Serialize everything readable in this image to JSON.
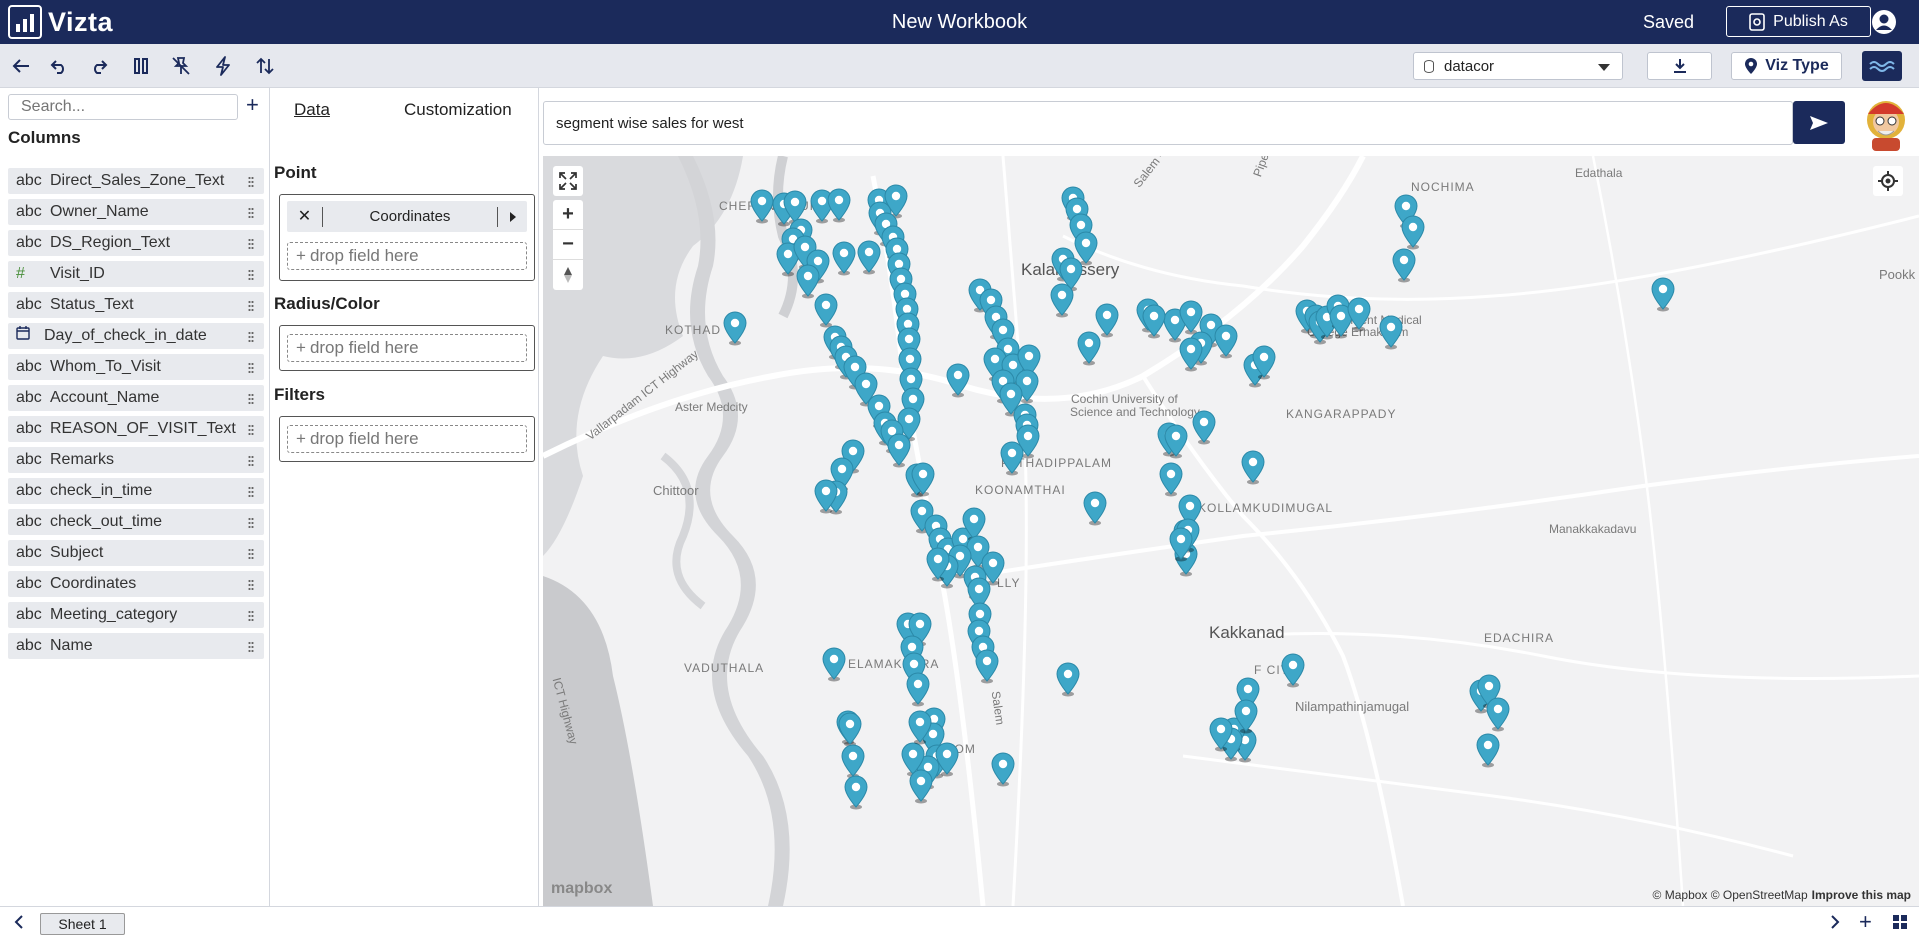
{
  "app": {
    "name": "Vizta",
    "workbook_title": "New Workbook",
    "save_status": "Saved",
    "publish_label": "Publish As"
  },
  "toolbar": {
    "datasource": "datacor",
    "viz_type_label": "Viz Type"
  },
  "columns_panel": {
    "search_placeholder": "Search...",
    "heading": "Columns",
    "columns": [
      {
        "type": "abc",
        "name": "Direct_Sales_Zone_Text"
      },
      {
        "type": "abc",
        "name": "Owner_Name"
      },
      {
        "type": "abc",
        "name": "DS_Region_Text"
      },
      {
        "type": "#",
        "name": "Visit_ID"
      },
      {
        "type": "abc",
        "name": "Status_Text"
      },
      {
        "type": "date-icon",
        "name": "Day_of_check_in_date"
      },
      {
        "type": "abc",
        "name": "Whom_To_Visit"
      },
      {
        "type": "abc",
        "name": "Account_Name"
      },
      {
        "type": "abc",
        "name": "REASON_OF_VISIT_Text"
      },
      {
        "type": "abc",
        "name": "Remarks"
      },
      {
        "type": "abc",
        "name": "check_in_time"
      },
      {
        "type": "abc",
        "name": "check_out_time"
      },
      {
        "type": "abc",
        "name": "Subject"
      },
      {
        "type": "abc",
        "name": "Coordinates"
      },
      {
        "type": "abc",
        "name": "Meeting_category"
      },
      {
        "type": "abc",
        "name": "Name"
      }
    ]
  },
  "config_panel": {
    "tab_data": "Data",
    "tab_customization": "Customization",
    "point_label": "Point",
    "point_field": "Coordinates",
    "radius_color_label": "Radius/Color",
    "filters_label": "Filters",
    "drop_placeholder": "drop field here"
  },
  "query": {
    "text": "segment wise sales for west"
  },
  "map": {
    "pin_color": "#3ea7c8",
    "place_labels": [
      "Kalamassery",
      "Kakkanad",
      "Cochin University of",
      "Science and Technology",
      "Aster Medcity",
      "Chittoor",
      "PATHADIPPALAM",
      "KOONAMTHAI",
      "KOLLAMKUDIMUGAL",
      "KANGARAPPADY",
      "CHERANALLUR",
      "KOTHAD",
      "VADUTHALA",
      "ELAMAKKARA",
      "EDACHIRA",
      "Nilampathinjamugal",
      "Manakkakadavu",
      "Edathala",
      "Pookk",
      "NOCHIMA",
      "Government Medical",
      "College Ernakulam",
      "Vallarpadam ICT Highway",
      "ICT Highway",
      "Salem - K",
      "Pipe",
      "Salem",
      "LLY",
      "ATTOM",
      "F CITY"
    ],
    "attribution": "© Mapbox © OpenStreetMap",
    "improve": "Improve this map",
    "logo": "mapbox"
  },
  "footer": {
    "sheet_tab": "Sheet 1"
  }
}
